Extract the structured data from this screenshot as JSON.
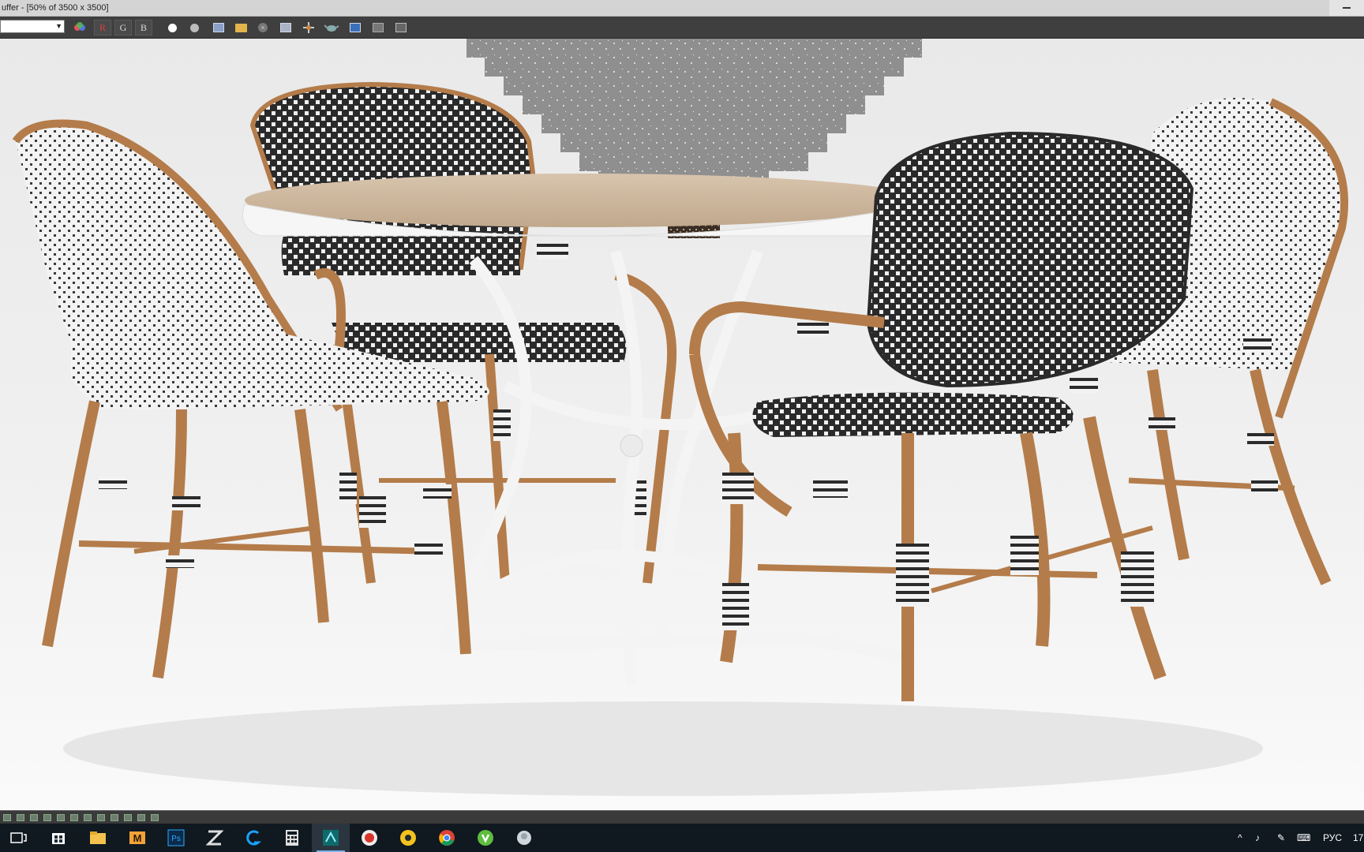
{
  "window": {
    "title": "uffer - [50% of 3500 x 3500]"
  },
  "toolbar": {
    "channel_select": {
      "value": ""
    },
    "buttons": [
      {
        "name": "color-picker-icon",
        "label": ""
      },
      {
        "name": "red-channel-button",
        "label": "R"
      },
      {
        "name": "green-channel-button",
        "label": "G"
      },
      {
        "name": "blue-channel-button",
        "label": "B"
      },
      {
        "name": "alpha-white-dot-icon",
        "label": ""
      },
      {
        "name": "mono-grey-dot-icon",
        "label": ""
      },
      {
        "name": "save-image-icon",
        "label": ""
      },
      {
        "name": "open-folder-icon",
        "label": ""
      },
      {
        "name": "clear-icon",
        "label": ""
      },
      {
        "name": "copy-icon",
        "label": ""
      },
      {
        "name": "clone-icon",
        "label": ""
      },
      {
        "name": "teapot-render-icon",
        "label": ""
      },
      {
        "name": "region-icon",
        "label": ""
      },
      {
        "name": "track-icon",
        "label": ""
      },
      {
        "name": "frame-icon",
        "label": ""
      }
    ]
  },
  "colors": {
    "rattan": "#b47c4a",
    "weave_dark": "#2a2a2a",
    "weave_light": "#f2f2f2",
    "table_top": "#cdb79e",
    "frame_white": "#f4f4f4"
  },
  "taskbar": {
    "apps": [
      "task-view-icon",
      "windows-store-icon",
      "file-explorer-icon",
      "gmail-icon",
      "photoshop-icon",
      "zbrush-icon",
      "logitech-icon",
      "calculator-icon",
      "3ds-max-icon",
      "record-icon",
      "browser-yellow-icon",
      "chrome-icon",
      "torrent-icon",
      "extra-app-icon"
    ],
    "tray": {
      "language": "РУС",
      "clock": "17"
    }
  }
}
